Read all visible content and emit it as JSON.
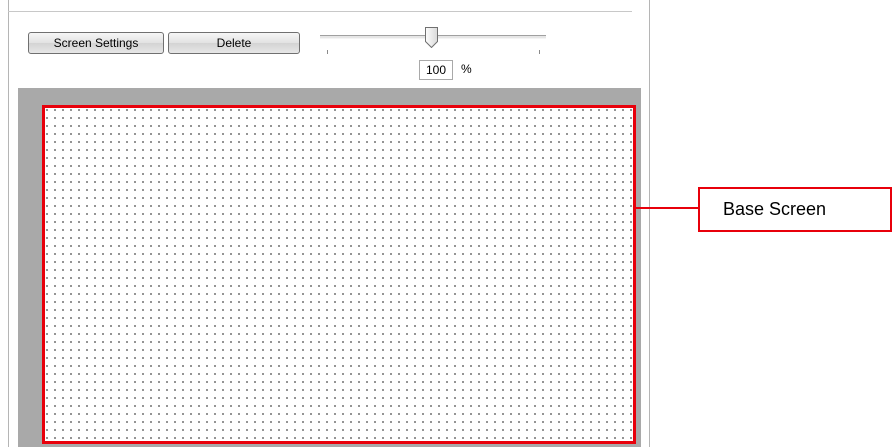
{
  "toolbar": {
    "screen_settings_label": "Screen Settings",
    "delete_label": "Delete"
  },
  "zoom": {
    "value": "100",
    "unit": "%",
    "slider_level_percent": 50
  },
  "annotation": {
    "label": "Base Screen"
  },
  "colors": {
    "annotation": "#e8000b",
    "workspace_background": "#a9a9a9",
    "grid_dot": "#777777"
  }
}
